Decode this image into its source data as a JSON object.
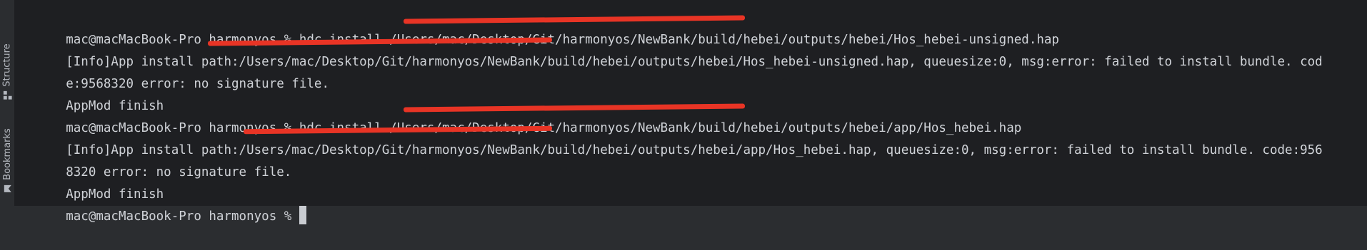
{
  "sidebar": {
    "structure_label": "Structure",
    "bookmarks_label": "Bookmarks",
    "structure_icon": "structure-icon",
    "bookmarks_icon": "bookmark-icon"
  },
  "terminal": {
    "lines": [
      "mac@macMacBook-Pro harmonyos % hdc install /Users/mac/Desktop/Git/harmonyos/NewBank/build/hebei/outputs/hebei/Hos_hebei-unsigned.hap",
      "[Info]App install path:/Users/mac/Desktop/Git/harmonyos/NewBank/build/hebei/outputs/hebei/Hos_hebei-unsigned.hap, queuesize:0, msg:error: failed to install bundle. cod",
      "e:9568320 error: no signature file.",
      "AppMod finish",
      "mac@macMacBook-Pro harmonyos % hdc install /Users/mac/Desktop/Git/harmonyos/NewBank/build/hebei/outputs/hebei/app/Hos_hebei.hap",
      "[Info]App install path:/Users/mac/Desktop/Git/harmonyos/NewBank/build/hebei/outputs/hebei/app/Hos_hebei.hap, queuesize:0, msg:error: failed to install bundle. code:956",
      "8320 error: no signature file.",
      "AppMod finish",
      "mac@macMacBook-Pro harmonyos % "
    ]
  },
  "colors": {
    "terminal_bg": "#1e1f22",
    "text": "#d0d3d8",
    "redaction": "#e83425",
    "cursor": "#c9ccd1"
  }
}
